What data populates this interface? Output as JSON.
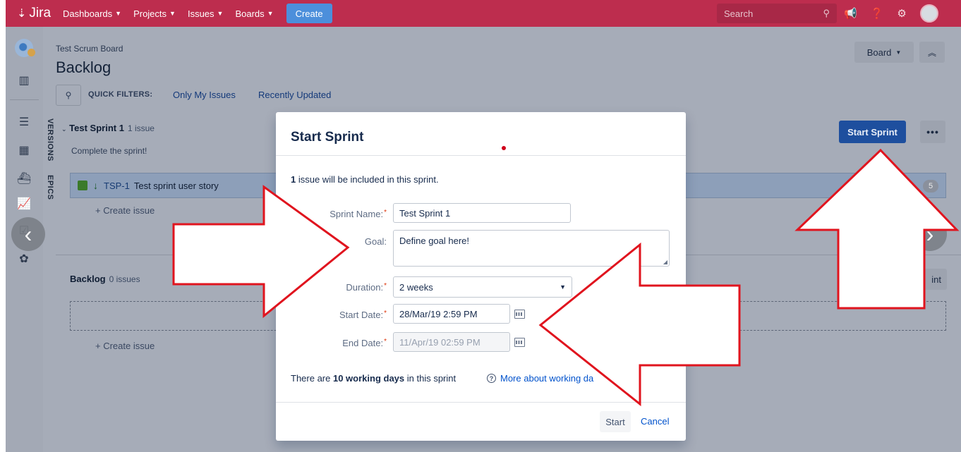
{
  "topnav": {
    "logo_text": "Jira",
    "menu": [
      {
        "label": "Dashboards"
      },
      {
        "label": "Projects"
      },
      {
        "label": "Issues"
      },
      {
        "label": "Boards"
      }
    ],
    "create_label": "Create",
    "search_placeholder": "Search"
  },
  "page": {
    "breadcrumb": "Test Scrum Board",
    "title": "Backlog",
    "quick_filters_label": "QUICK FILTERS:",
    "quick_filters": [
      "Only My Issues",
      "Recently Updated"
    ],
    "board_button": "Board",
    "side_tabs": [
      "VERSIONS",
      "EPICS"
    ]
  },
  "sprint": {
    "name": "Test Sprint 1",
    "count": "1 issue",
    "goal_hint": "Complete the sprint!",
    "start_button": "Start Sprint",
    "issue": {
      "key": "TSP-1",
      "summary": "Test sprint user story",
      "estimate": "5"
    },
    "create_issue": "+ Create issue"
  },
  "backlog": {
    "name": "Backlog",
    "count": "0 issues",
    "create_sprint_partial": "int",
    "create_issue": "+ Create issue"
  },
  "dialog": {
    "title": "Start Sprint",
    "info_count": "1",
    "info_text": " issue will be included in this sprint.",
    "labels": {
      "sprint_name": "Sprint Name:",
      "goal": "Goal:",
      "duration": "Duration:",
      "start_date": "Start Date:",
      "end_date": "End Date:"
    },
    "values": {
      "sprint_name": "Test Sprint 1",
      "goal": "Define goal here!",
      "duration": "2 weeks",
      "start_date": "28/Mar/19 2:59 PM",
      "end_date": "11/Apr/19 02:59 PM"
    },
    "working_prefix": "There are ",
    "working_bold": "10 working days",
    "working_suffix": " in this sprint",
    "help_link": "More about working da",
    "start_button": "Start",
    "cancel_link": "Cancel"
  },
  "colors": {
    "topnav": "#bd2d4e",
    "start_sprint_button": "#1e4f9e",
    "annotation_arrow": "#e0141e"
  }
}
